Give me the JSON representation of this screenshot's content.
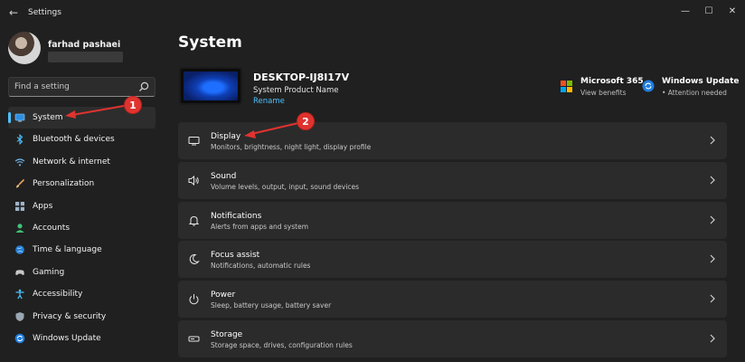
{
  "window": {
    "title": "Settings",
    "back_icon": "back-arrow-icon",
    "controls": {
      "minimize": "—",
      "maximize": "☐",
      "close": "✕"
    }
  },
  "profile": {
    "name": "farhad pashaei"
  },
  "search": {
    "placeholder": "Find a setting"
  },
  "sidebar": {
    "items": [
      {
        "label": "System",
        "icon": "display-icon",
        "active": true
      },
      {
        "label": "Bluetooth & devices",
        "icon": "bluetooth-icon"
      },
      {
        "label": "Network & internet",
        "icon": "wifi-icon"
      },
      {
        "label": "Personalization",
        "icon": "brush-icon"
      },
      {
        "label": "Apps",
        "icon": "apps-icon"
      },
      {
        "label": "Accounts",
        "icon": "person-icon"
      },
      {
        "label": "Time & language",
        "icon": "globe-clock-icon"
      },
      {
        "label": "Gaming",
        "icon": "gamepad-icon"
      },
      {
        "label": "Accessibility",
        "icon": "accessibility-icon"
      },
      {
        "label": "Privacy & security",
        "icon": "shield-icon"
      },
      {
        "label": "Windows Update",
        "icon": "update-icon"
      }
    ]
  },
  "main": {
    "title": "System",
    "device": {
      "name": "DESKTOP-IJ8I17V",
      "model": "System Product Name",
      "rename": "Rename"
    },
    "quick": [
      {
        "title": "Microsoft 365",
        "sub": "View benefits"
      },
      {
        "title": "Windows Update",
        "sub": "• Attention needed"
      }
    ],
    "cards": [
      {
        "title": "Display",
        "sub": "Monitors, brightness, night light, display profile",
        "icon": "monitor-icon"
      },
      {
        "title": "Sound",
        "sub": "Volume levels, output, input, sound devices",
        "icon": "speaker-icon"
      },
      {
        "title": "Notifications",
        "sub": "Alerts from apps and system",
        "icon": "bell-icon"
      },
      {
        "title": "Focus assist",
        "sub": "Notifications, automatic rules",
        "icon": "moon-icon"
      },
      {
        "title": "Power",
        "sub": "Sleep, battery usage, battery saver",
        "icon": "power-icon"
      },
      {
        "title": "Storage",
        "sub": "Storage space, drives, configuration rules",
        "icon": "storage-icon"
      }
    ]
  },
  "annotations": {
    "one": "1",
    "two": "2"
  },
  "colors": {
    "accent": "#4cc2ff",
    "badge": "#e0332f",
    "background": "#202020",
    "card": "#2b2b2b"
  }
}
